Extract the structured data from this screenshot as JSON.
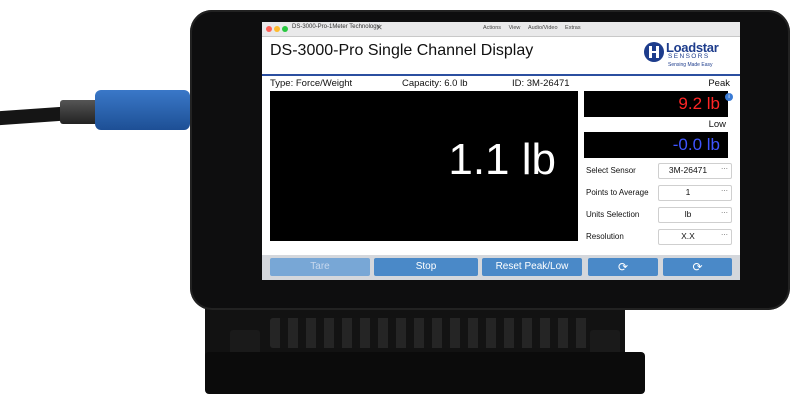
{
  "window": {
    "title": "DS-3000-Pro-1Meter Technology",
    "menu": [
      "Actions",
      "View",
      "Audio/Video",
      "Extras"
    ]
  },
  "app": {
    "title": "DS-3000-Pro Single Channel Display",
    "logo": {
      "brand": "Loadstar",
      "brand_sub": "SENSORS",
      "tagline": "Sensing Made Easy"
    }
  },
  "sensor_info": {
    "type": "Type: Force/Weight",
    "capacity": "Capacity: 6.0 lb",
    "id": "ID: 3M-26471"
  },
  "main_reading": "1.1 lb",
  "peak": {
    "label": "Peak",
    "value": "9.2 lb",
    "color": "#ff2525"
  },
  "low": {
    "label": "Low",
    "value": "-0.0 lb",
    "color": "#3f55ff"
  },
  "settings": [
    {
      "label": "Select Sensor",
      "value": "3M-26471"
    },
    {
      "label": "Points to Average",
      "value": "1"
    },
    {
      "label": "Units Selection",
      "value": "lb"
    },
    {
      "label": "Resolution",
      "value": "X.X"
    }
  ],
  "buttons": {
    "tare": "Tare",
    "stop": "Stop",
    "reset": "Reset Peak/Low"
  },
  "icons": {
    "refresh": "refresh-icon",
    "dropdown": "more-dots-icon"
  },
  "colors": {
    "accent": "#2b4fa0",
    "button": "#4a89c8"
  }
}
